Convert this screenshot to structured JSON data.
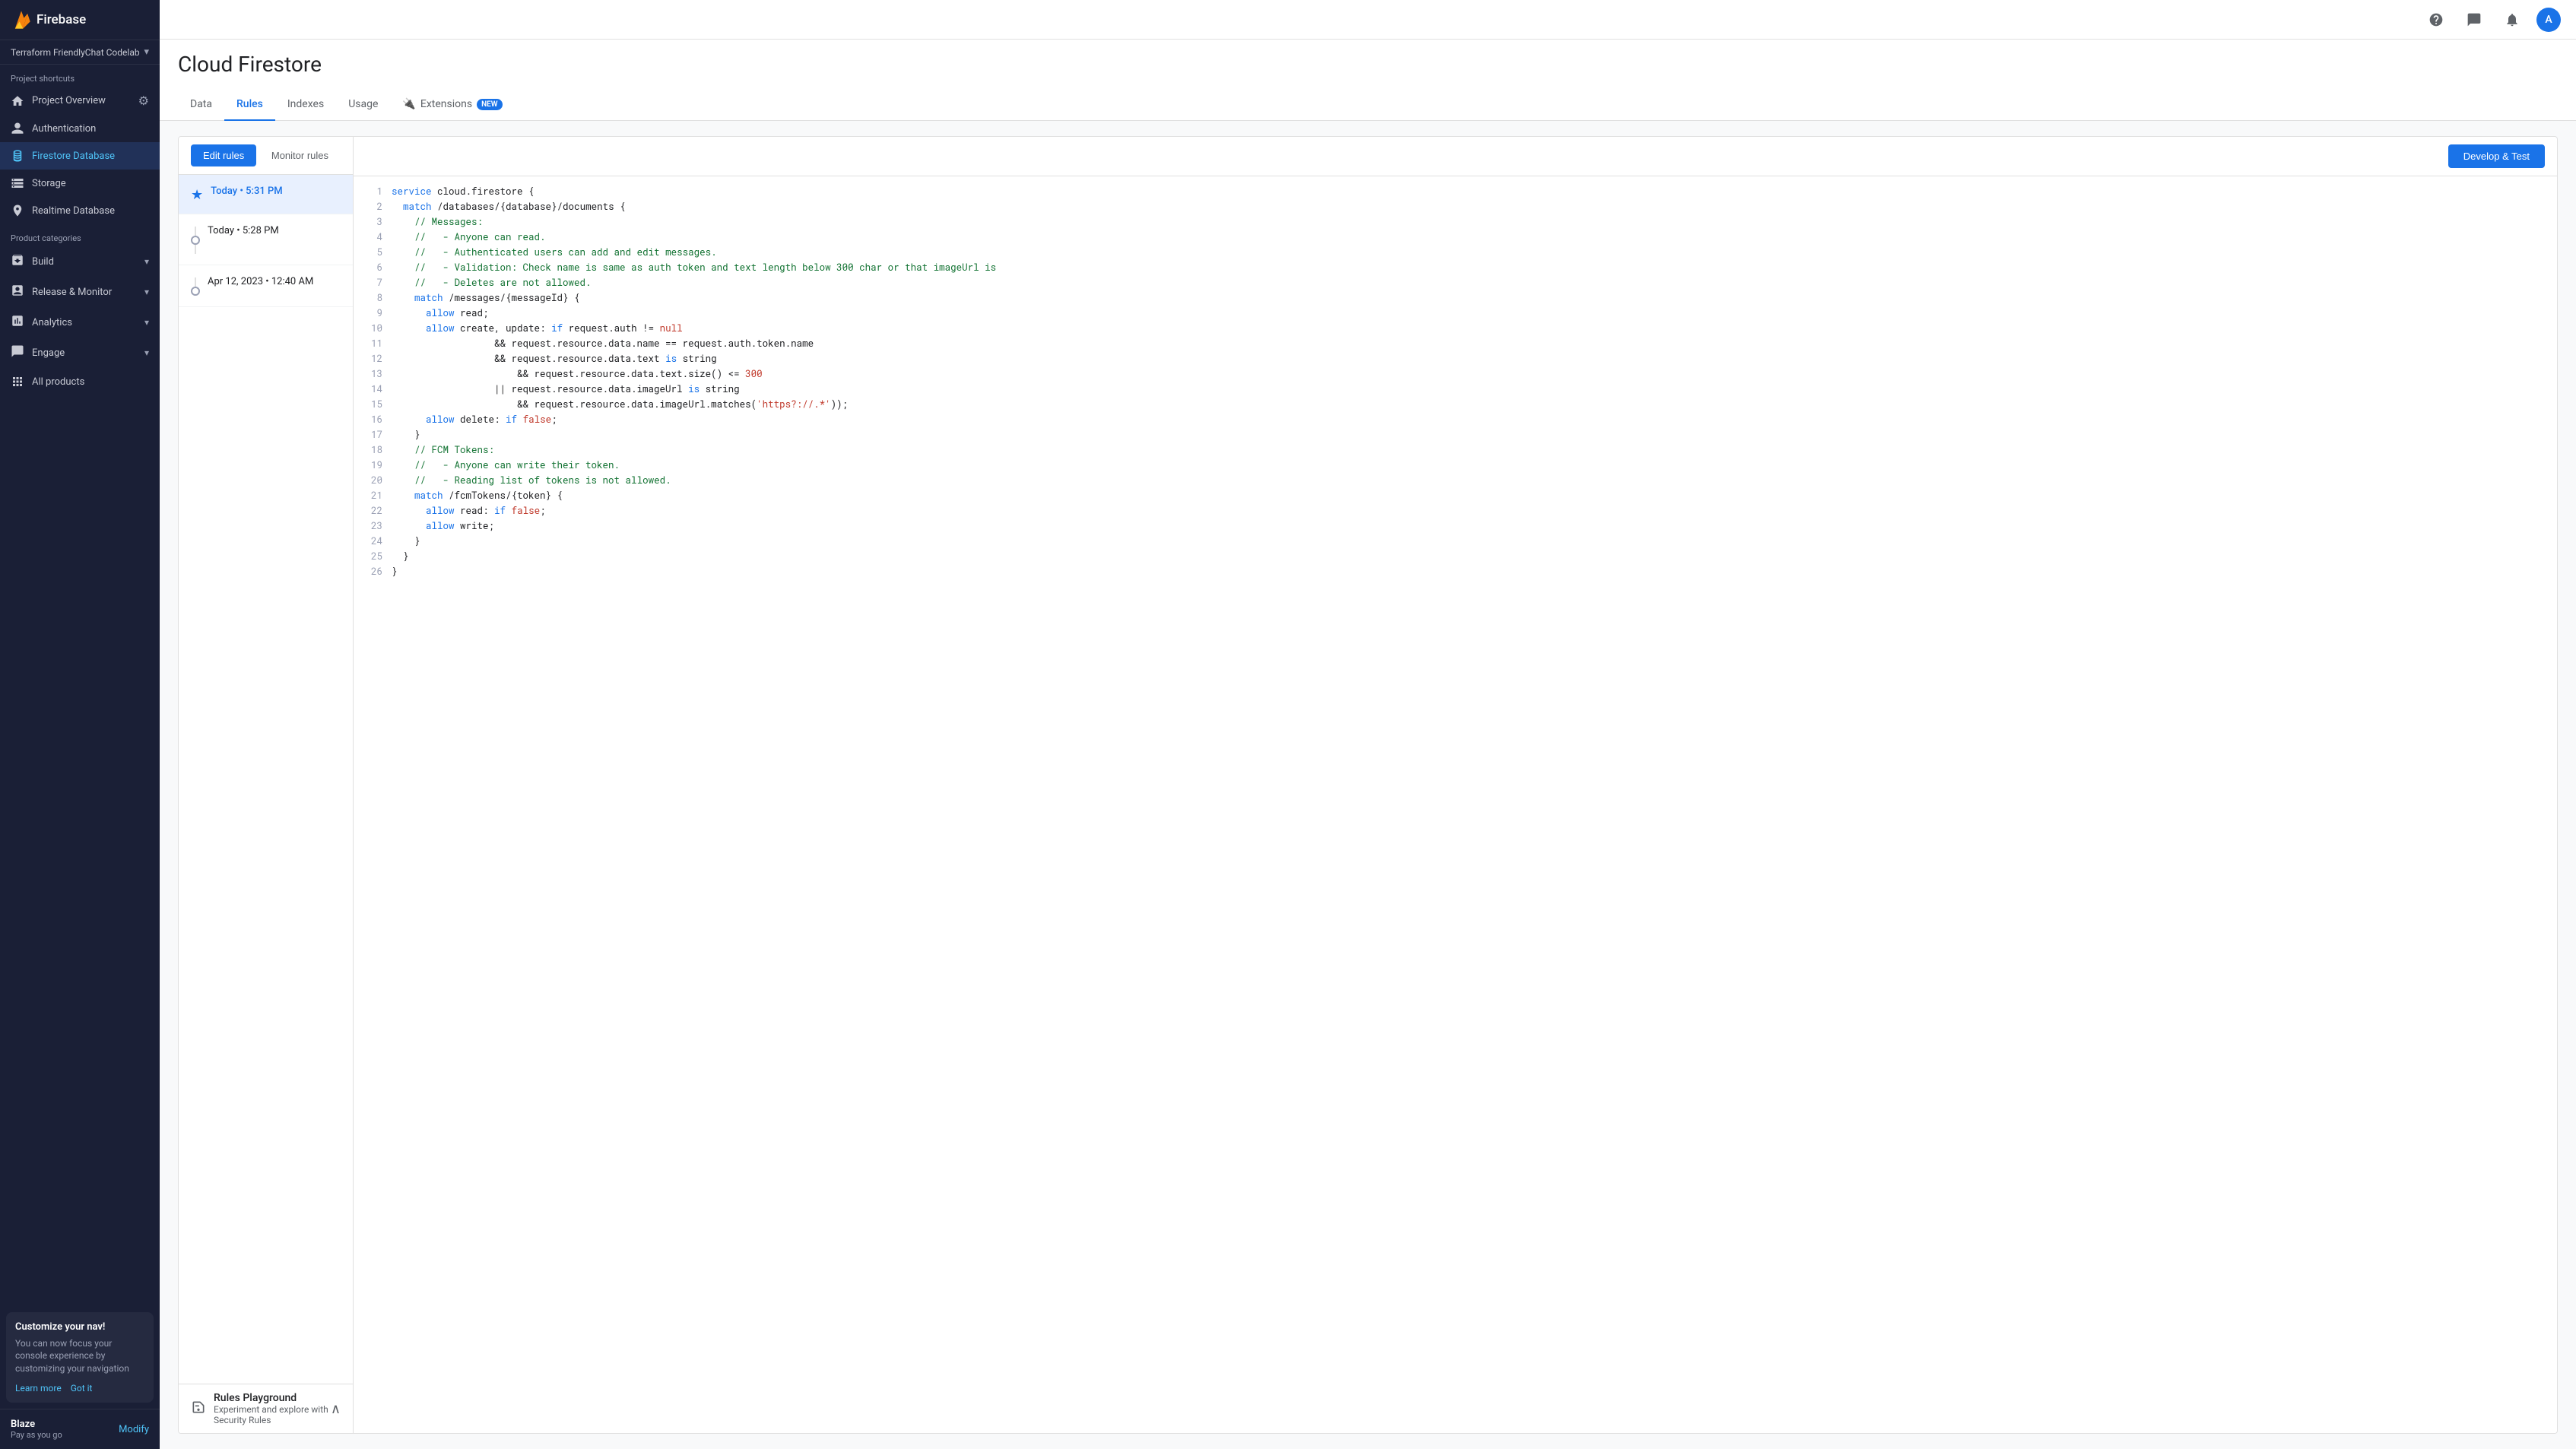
{
  "app": {
    "brand": "Firebase",
    "project": "Terraform FriendlyChat Codelab"
  },
  "sidebar": {
    "header_title": "Firebase",
    "project_name": "Terraform FriendlyChat Codelab",
    "shortcuts_label": "Project shortcuts",
    "items": [
      {
        "id": "project-overview",
        "label": "Project Overview",
        "icon": "home"
      },
      {
        "id": "authentication",
        "label": "Authentication",
        "icon": "auth"
      },
      {
        "id": "firestore-database",
        "label": "Firestore Database",
        "icon": "db",
        "active": true
      },
      {
        "id": "storage",
        "label": "Storage",
        "icon": "storage"
      },
      {
        "id": "realtime-database",
        "label": "Realtime Database",
        "icon": "realtime"
      }
    ],
    "product_categories_label": "Product categories",
    "groups": [
      {
        "id": "build",
        "label": "Build",
        "expanded": false
      },
      {
        "id": "release-monitor",
        "label": "Release & Monitor",
        "expanded": false
      },
      {
        "id": "analytics",
        "label": "Analytics",
        "expanded": false
      },
      {
        "id": "engage",
        "label": "Engage",
        "expanded": false
      }
    ],
    "all_products": "All products",
    "customize_banner": {
      "title": "Customize your nav!",
      "body": "You can now focus your console experience by customizing your navigation",
      "learn_more": "Learn more",
      "got_it": "Got it"
    },
    "plan": {
      "name": "Blaze",
      "sub": "Pay as you go",
      "modify": "Modify"
    }
  },
  "topbar": {
    "icons": [
      "help",
      "chat",
      "notifications",
      "avatar"
    ],
    "avatar_letter": "A"
  },
  "content": {
    "page_title": "Cloud Firestore",
    "tabs": [
      {
        "id": "data",
        "label": "Data",
        "active": false
      },
      {
        "id": "rules",
        "label": "Rules",
        "active": true
      },
      {
        "id": "indexes",
        "label": "Indexes",
        "active": false
      },
      {
        "id": "usage",
        "label": "Usage",
        "active": false
      },
      {
        "id": "extensions",
        "label": "Extensions",
        "active": false,
        "badge": "NEW"
      }
    ]
  },
  "rules_editor": {
    "edit_rules_label": "Edit rules",
    "monitor_rules_label": "Monitor rules",
    "develop_test_label": "Develop & Test",
    "versions": [
      {
        "id": "v1",
        "date": "Today • 5:31 PM",
        "active": true,
        "icon": "star"
      },
      {
        "id": "v2",
        "date": "Today • 5:28 PM",
        "active": false
      },
      {
        "id": "v3",
        "date": "Apr 12, 2023 • 12:40 AM",
        "active": false
      }
    ],
    "code_lines": [
      {
        "n": 1,
        "code": "service cloud.firestore {",
        "type": "plain"
      },
      {
        "n": 2,
        "code": "  match /databases/{database}/documents {",
        "type": "plain"
      },
      {
        "n": 3,
        "code": "    // Messages:",
        "type": "comment_green"
      },
      {
        "n": 4,
        "code": "    //   - Anyone can read.",
        "type": "comment_green"
      },
      {
        "n": 5,
        "code": "    //   - Authenticated users can add and edit messages.",
        "type": "comment_green"
      },
      {
        "n": 6,
        "code": "    //   - Validation: Check name is same as auth token and text length below 300 char or that imageUrl is",
        "type": "comment_green"
      },
      {
        "n": 7,
        "code": "    //   - Deletes are not allowed.",
        "type": "comment_green"
      },
      {
        "n": 8,
        "code": "    match /messages/{messageId} {",
        "type": "plain"
      },
      {
        "n": 9,
        "code": "      allow read;",
        "type": "plain"
      },
      {
        "n": 10,
        "code": "      allow create, update: if request.auth != null",
        "type": "plain"
      },
      {
        "n": 11,
        "code": "                  && request.resource.data.name == request.auth.token.name",
        "type": "plain"
      },
      {
        "n": 12,
        "code": "                  && request.resource.data.text is string",
        "type": "plain"
      },
      {
        "n": 13,
        "code": "                      && request.resource.data.text.size() <= 300",
        "type": "plain_red300"
      },
      {
        "n": 14,
        "code": "                  || request.resource.data.imageUrl is string",
        "type": "plain"
      },
      {
        "n": 15,
        "code": "                      && request.resource.data.imageUrl.matches('https?://.*'));",
        "type": "plain_str"
      },
      {
        "n": 16,
        "code": "      allow delete: if false;",
        "type": "plain"
      },
      {
        "n": 17,
        "code": "    }",
        "type": "plain"
      },
      {
        "n": 18,
        "code": "    // FCM Tokens:",
        "type": "comment_green"
      },
      {
        "n": 19,
        "code": "    //   - Anyone can write their token.",
        "type": "comment_green"
      },
      {
        "n": 20,
        "code": "    //   - Reading list of tokens is not allowed.",
        "type": "comment_green"
      },
      {
        "n": 21,
        "code": "    match /fcmTokens/{token} {",
        "type": "plain"
      },
      {
        "n": 22,
        "code": "      allow read: if false;",
        "type": "plain"
      },
      {
        "n": 23,
        "code": "      allow write;",
        "type": "plain"
      },
      {
        "n": 24,
        "code": "    }",
        "type": "plain"
      },
      {
        "n": 25,
        "code": "  }",
        "type": "plain"
      },
      {
        "n": 26,
        "code": "}",
        "type": "plain"
      }
    ]
  },
  "playground": {
    "title": "Rules Playground",
    "subtitle": "Experiment and explore with Security Rules",
    "chevron": "expand_less"
  }
}
